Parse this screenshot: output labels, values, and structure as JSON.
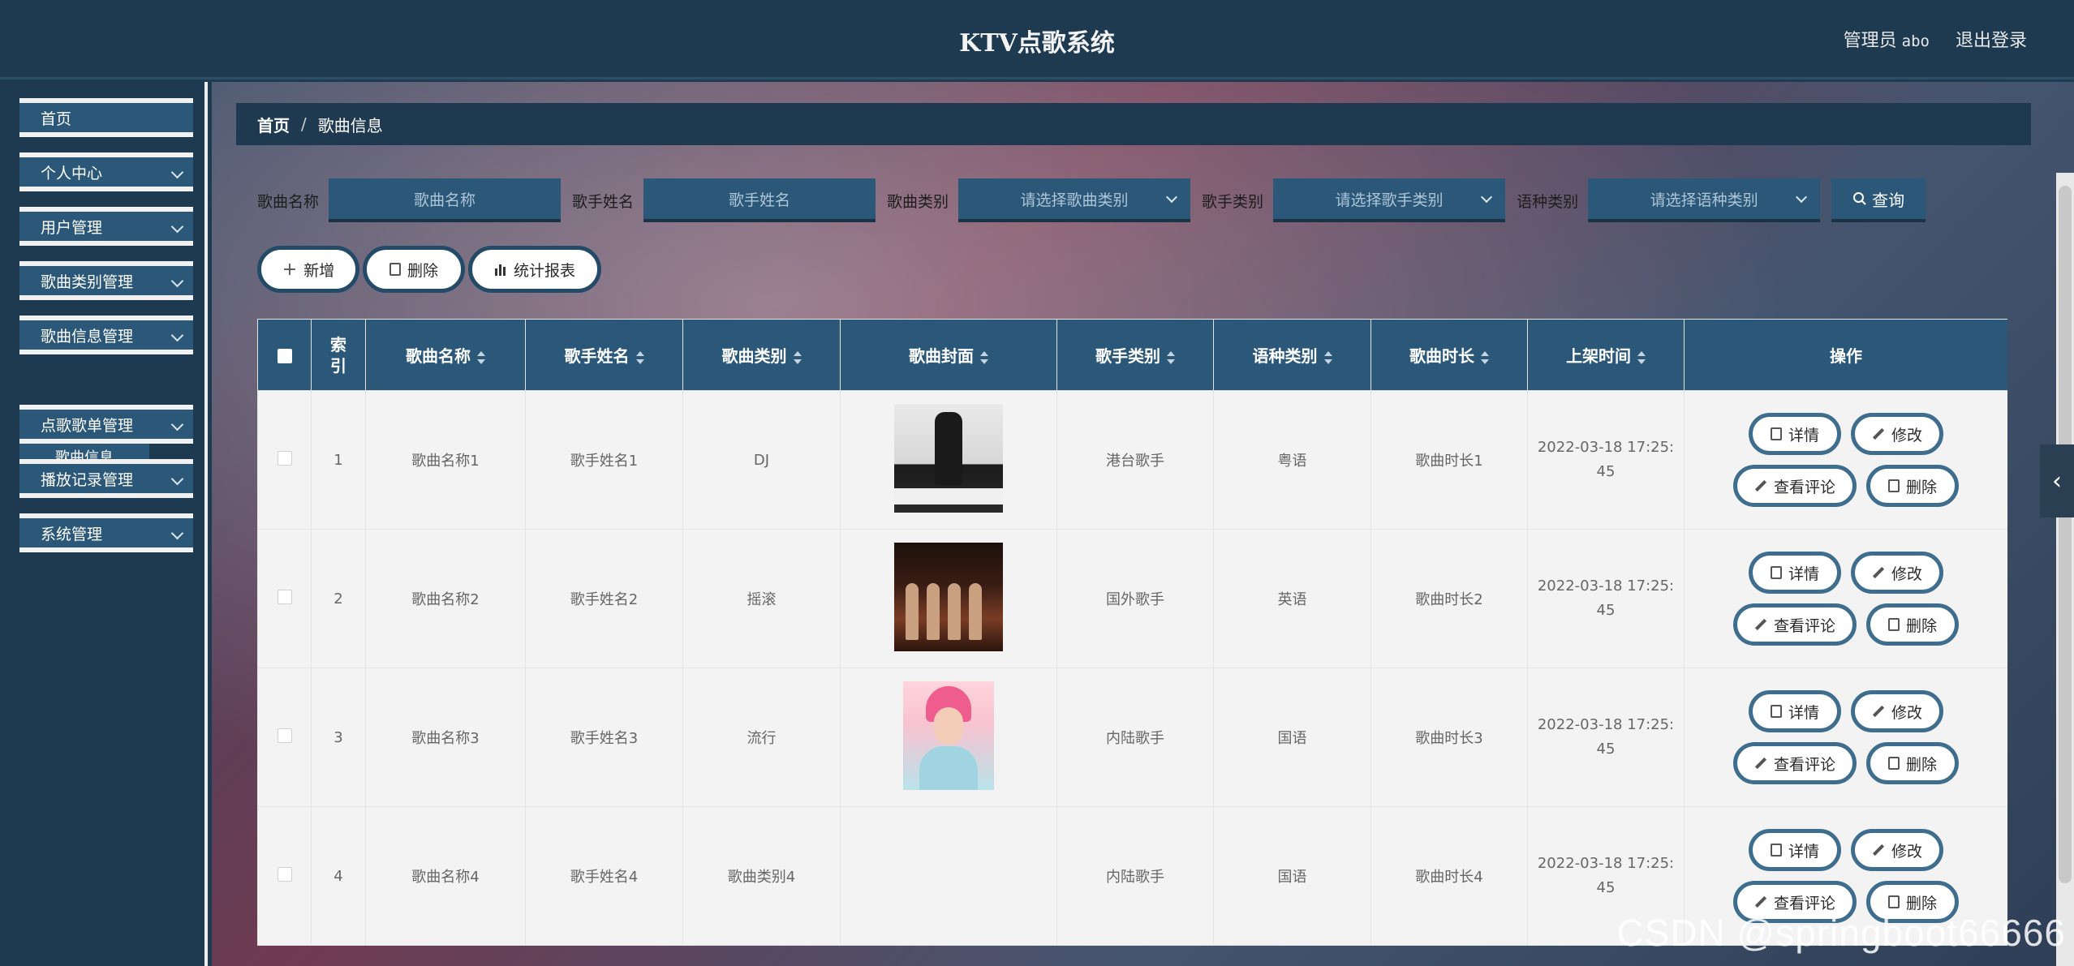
{
  "header": {
    "title": "KTV点歌系统",
    "user_role": "管理员",
    "user_name": "abo",
    "logout": "退出登录"
  },
  "sidebar": {
    "items": [
      {
        "label": "首页"
      },
      {
        "label": "个人中心"
      },
      {
        "label": "用户管理"
      },
      {
        "label": "歌曲类别管理"
      },
      {
        "label": "歌曲信息管理"
      },
      {
        "label": "点歌歌单管理"
      },
      {
        "label": "播放记录管理"
      },
      {
        "label": "系统管理"
      }
    ],
    "submenu": {
      "label": "歌曲信息"
    }
  },
  "breadcrumb": {
    "home": "首页",
    "separator": "/",
    "current": "歌曲信息"
  },
  "search": {
    "song_name_label": "歌曲名称",
    "song_name_placeholder": "歌曲名称",
    "singer_name_label": "歌手姓名",
    "singer_name_placeholder": "歌手姓名",
    "song_type_label": "歌曲类别",
    "song_type_placeholder": "请选择歌曲类别",
    "singer_type_label": "歌手类别",
    "singer_type_placeholder": "请选择歌手类别",
    "language_label": "语种类别",
    "language_placeholder": "请选择语种类别",
    "query_button": "查询"
  },
  "actions": {
    "add": "新增",
    "delete": "删除",
    "report": "统计报表"
  },
  "table": {
    "headers": {
      "index": "索引",
      "song_name": "歌曲名称",
      "singer_name": "歌手姓名",
      "song_type": "歌曲类别",
      "cover": "歌曲封面",
      "singer_type": "歌手类别",
      "language": "语种类别",
      "duration": "歌曲时长",
      "listed_time": "上架时间",
      "operations": "操作"
    },
    "rows": [
      {
        "index": "1",
        "song_name": "歌曲名称1",
        "singer_name": "歌手姓名1",
        "song_type": "DJ",
        "singer_type": "港台歌手",
        "language": "粤语",
        "duration": "歌曲时长1",
        "time_a": "2022-03-18 17:25:",
        "time_b": "45"
      },
      {
        "index": "2",
        "song_name": "歌曲名称2",
        "singer_name": "歌手姓名2",
        "song_type": "摇滚",
        "singer_type": "国外歌手",
        "language": "英语",
        "duration": "歌曲时长2",
        "time_a": "2022-03-18 17:25:",
        "time_b": "45"
      },
      {
        "index": "3",
        "song_name": "歌曲名称3",
        "singer_name": "歌手姓名3",
        "song_type": "流行",
        "singer_type": "内陆歌手",
        "language": "国语",
        "duration": "歌曲时长3",
        "time_a": "2022-03-18 17:25:",
        "time_b": "45"
      },
      {
        "index": "4",
        "song_name": "歌曲名称4",
        "singer_name": "歌手姓名4",
        "song_type": "歌曲类别4",
        "singer_type": "内陆歌手",
        "language": "国语",
        "duration": "歌曲时长4",
        "time_a": "2022-03-18 17:25:",
        "time_b": "45"
      }
    ],
    "row_buttons": {
      "detail": "详情",
      "edit": "修改",
      "comments": "查看评论",
      "delete": "删除"
    }
  },
  "watermark": "CSDN @springboot66666",
  "icons": {
    "collapse": "chevron-left-icon",
    "search": "search-icon"
  },
  "colors": {
    "header_bg": "#1e3a50",
    "accent": "#2b5878",
    "table_row_bg": "#f3f3f3"
  }
}
